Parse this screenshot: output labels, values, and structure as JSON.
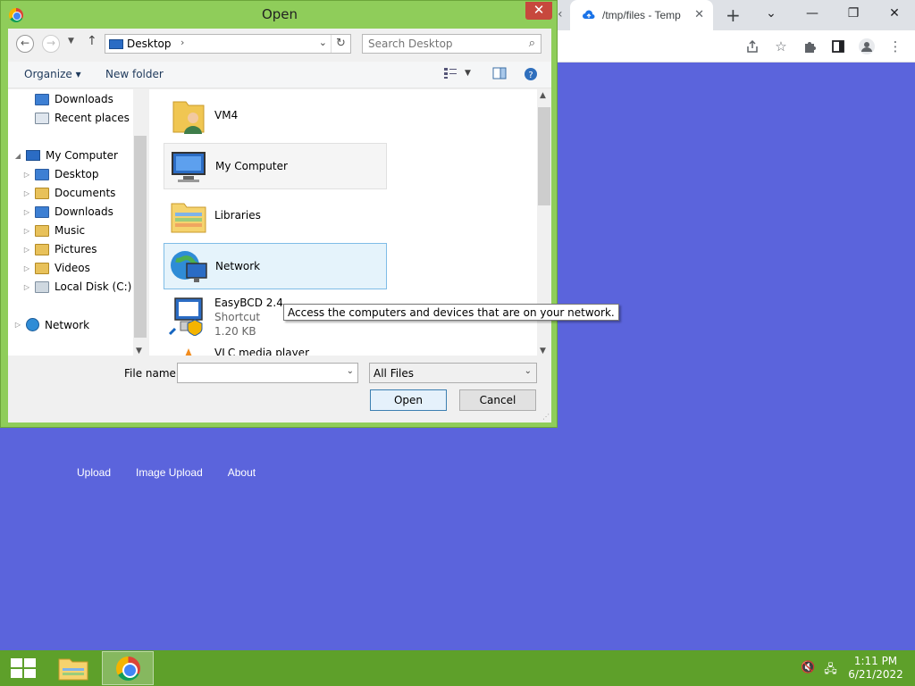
{
  "browser": {
    "tab_title": "/tmp/files - Temp",
    "tab_close": "✕",
    "new_tab": "+",
    "win_buttons": [
      "⌄",
      "—",
      "❐",
      "✕"
    ],
    "site_nav": [
      "Upload",
      "Image Upload",
      "About"
    ]
  },
  "dialog": {
    "title": "Open",
    "close": "✕",
    "address": {
      "crumb": "Desktop"
    },
    "search": {
      "placeholder": "Search Desktop"
    },
    "commands": {
      "organize": "Organize ▾",
      "new_folder": "New folder"
    },
    "nav_tree": [
      {
        "label": "Downloads",
        "icon": "downloads-folder-icon"
      },
      {
        "label": "Recent places",
        "icon": "recent-places-icon"
      },
      {
        "label": "My Computer",
        "icon": "computer-icon"
      },
      {
        "label": "Desktop",
        "icon": "desktop-folder-icon"
      },
      {
        "label": "Documents",
        "icon": "documents-folder-icon"
      },
      {
        "label": "Downloads",
        "icon": "downloads-folder-icon"
      },
      {
        "label": "Music",
        "icon": "music-folder-icon"
      },
      {
        "label": "Pictures",
        "icon": "pictures-folder-icon"
      },
      {
        "label": "Videos",
        "icon": "videos-folder-icon"
      },
      {
        "label": "Local Disk (C:)",
        "icon": "drive-icon"
      },
      {
        "label": "Network",
        "icon": "network-icon"
      }
    ],
    "files": [
      {
        "name": "VM4"
      },
      {
        "name": "My Computer"
      },
      {
        "name": "Libraries"
      },
      {
        "name": "Network"
      },
      {
        "name": "EasyBCD 2.4",
        "type": "Shortcut",
        "size": "1.20 KB"
      },
      {
        "name": "VLC media player"
      }
    ],
    "tooltip": "Access the computers and devices that are on your network.",
    "file_name_label": "File name:",
    "file_name_value": "",
    "file_type": "All Files",
    "open_button": "Open",
    "cancel_button": "Cancel"
  },
  "taskbar": {
    "time": "1:11 PM",
    "date": "6/21/2022"
  }
}
